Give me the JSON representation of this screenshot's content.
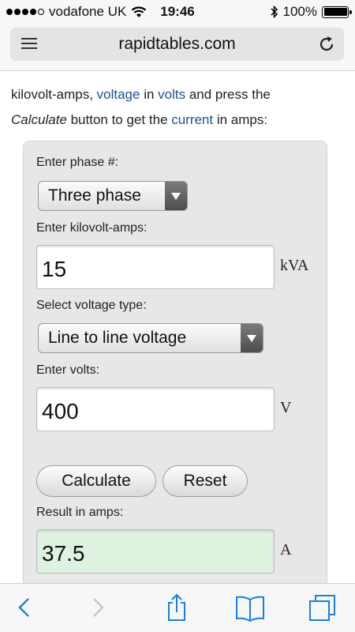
{
  "status_bar": {
    "carrier": "vodafone UK",
    "time": "19:46",
    "battery": "100%",
    "signal_bars_filled": 4,
    "signal_bars_total": 5
  },
  "browser": {
    "url": "rapidtables.com",
    "reader_icon": "reader-list-icon",
    "reload_icon": "reload-icon",
    "accent": "#1a7fe0"
  },
  "intro": {
    "line1_text": "kilovolt-amps, ",
    "link_voltage": "voltage",
    "in_word": " in ",
    "link_volts": "volts",
    "line1_end": " and press the",
    "calculate_word": "Calculate",
    "line2_mid": " button to get the ",
    "link_current": "current",
    "line2_end": " in amps:",
    "link_color": "#1e4f9a"
  },
  "calculator": {
    "phase_label": "Enter phase #:",
    "phase_selected": "Three phase",
    "kva_label": "Enter kilovolt-amps:",
    "kva_value": "15",
    "kva_unit": "kVA",
    "voltage_type_label": "Select voltage type:",
    "voltage_type_selected": "Line to line voltage",
    "volts_label": "Enter volts:",
    "volts_value": "400",
    "volts_unit": "V",
    "calculate_button": "Calculate",
    "reset_button": "Reset",
    "result_label": "Result in amps:",
    "result_value": "37.5",
    "result_unit": "A",
    "result_bg": "#dff1df"
  },
  "toolbar": {
    "icons": [
      "back-icon",
      "forward-icon",
      "share-icon",
      "bookmarks-icon",
      "tabs-icon"
    ]
  }
}
